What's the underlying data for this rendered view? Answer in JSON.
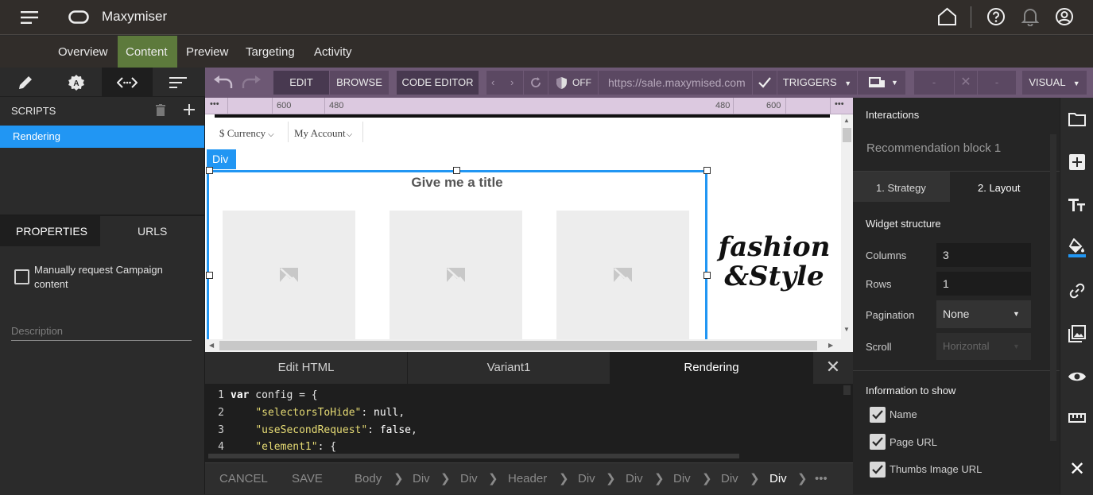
{
  "app": {
    "title": "Maxymiser"
  },
  "nav": {
    "tabs": [
      {
        "label": "Overview"
      },
      {
        "label": "Content"
      },
      {
        "label": "Preview"
      },
      {
        "label": "Targeting"
      },
      {
        "label": "Activity"
      }
    ]
  },
  "left": {
    "scripts_label": "SCRIPTS",
    "scripts": [
      {
        "label": "Rendering"
      }
    ],
    "tabs": {
      "properties": "PROPERTIES",
      "urls": "URLS"
    },
    "manual_request_label": "Manually request Campaign content",
    "description_placeholder": "Description"
  },
  "toolbar": {
    "edit": "EDIT",
    "browse": "BROWSE",
    "code_editor": "CODE EDITOR",
    "off": "OFF",
    "url": "https://sale.maxymised.com",
    "triggers": "TRIGGERS",
    "visual": "VISUAL",
    "blank1": "-",
    "blank2": "-"
  },
  "ruler": {
    "l1": "600",
    "l2": "480",
    "r1": "480",
    "r2": "600",
    "dots": "•••"
  },
  "canvas": {
    "currency": "$ Currency",
    "account": "My Account",
    "div_tag": "Div",
    "block_title": "Give me a title",
    "logo_line1": "fashion",
    "logo_line2": "&Style"
  },
  "editor": {
    "tabs": [
      {
        "label": "Edit HTML"
      },
      {
        "label": "Variant1"
      },
      {
        "label": "Rendering"
      }
    ],
    "lines": [
      {
        "n": "1",
        "kw": "var",
        "rest": " config = {"
      },
      {
        "n": "2",
        "str": "\"selectorsToHide\"",
        "rest": ": ",
        "lit": "null",
        "end": ","
      },
      {
        "n": "3",
        "str": "\"useSecondRequest\"",
        "rest": ": ",
        "lit": "false",
        "end": ","
      },
      {
        "n": "4",
        "str": "\"element1\"",
        "rest": ": {"
      }
    ]
  },
  "bottom": {
    "cancel": "CANCEL",
    "save": "SAVE",
    "crumbs": [
      "Body",
      "Div",
      "Div",
      "Header",
      "Div",
      "Div",
      "Div",
      "Div",
      "Div"
    ],
    "more": "•••"
  },
  "right": {
    "interactions": "Interactions",
    "block_name": "Recommendation block 1",
    "tabs": {
      "strategy": "1. Strategy",
      "layout": "2. Layout"
    },
    "widget_structure": "Widget structure",
    "columns_label": "Columns",
    "columns_value": "3",
    "rows_label": "Rows",
    "rows_value": "1",
    "pagination_label": "Pagination",
    "pagination_value": "None",
    "scroll_label": "Scroll",
    "scroll_value": "Horizontal",
    "info_label": "Information to show",
    "info_items": [
      {
        "label": "Name"
      },
      {
        "label": "Page URL"
      },
      {
        "label": "Thumbs Image URL"
      }
    ]
  },
  "colors": {
    "accent": "#2196f3",
    "nav_active": "#5d7a3c",
    "toolbar": "#6d5874"
  }
}
